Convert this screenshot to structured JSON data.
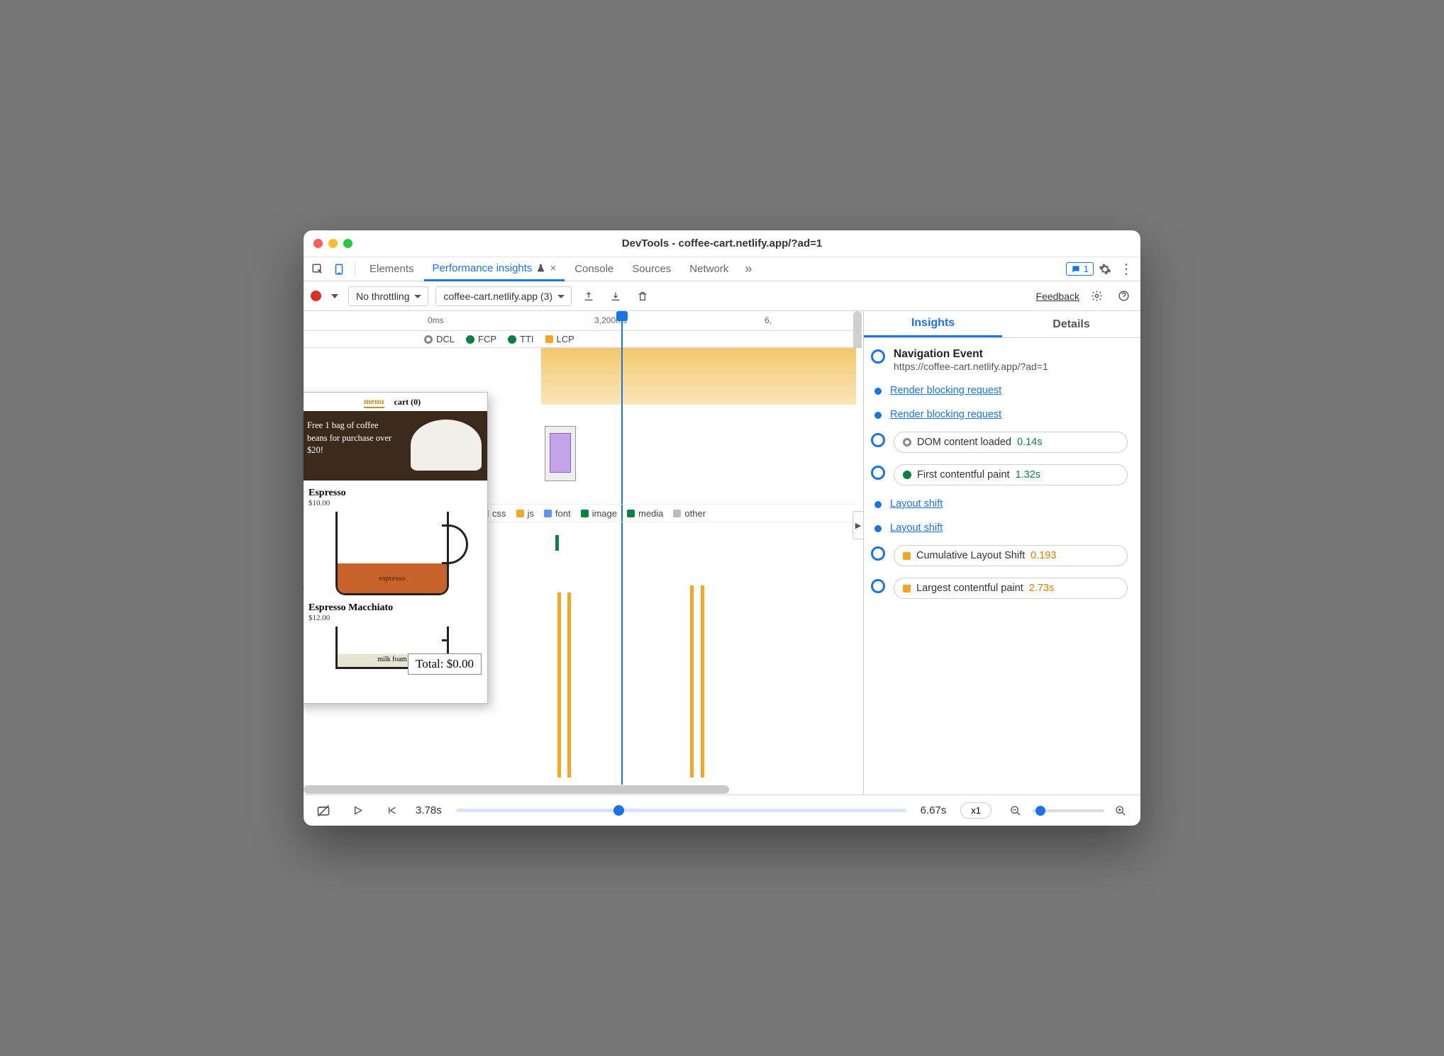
{
  "window": {
    "title": "DevTools - coffee-cart.netlify.app/?ad=1"
  },
  "tabs": {
    "elements": "Elements",
    "perf": "Performance insights",
    "console": "Console",
    "sources": "Sources",
    "network": "Network"
  },
  "badge": {
    "count": "1"
  },
  "toolbar": {
    "throttling": "No throttling",
    "session": "coffee-cart.netlify.app (3)",
    "feedback": "Feedback"
  },
  "ruler": {
    "t0": "0ms",
    "t1": "3,200ms",
    "t2": "6,"
  },
  "markers": {
    "dcl": "DCL",
    "fcp": "FCP",
    "tti": "TTI",
    "lcp": "LCP"
  },
  "legend": {
    "css": "css",
    "js": "js",
    "font": "font",
    "image": "image",
    "media": "media",
    "other": "other"
  },
  "right_tabs": {
    "insights": "Insights",
    "details": "Details"
  },
  "insights": {
    "nav_title": "Navigation Event",
    "nav_url": "https://coffee-cart.netlify.app/?ad=1",
    "rbr": "Render blocking request",
    "dcl_label": "DOM content loaded",
    "dcl_val": "0.14s",
    "fcp_label": "First contentful paint",
    "fcp_val": "1.32s",
    "ls": "Layout shift",
    "cls_label": "Cumulative Layout Shift",
    "cls_val": "0.193",
    "lcp_label": "Largest contentful paint",
    "lcp_val": "2.73s"
  },
  "bottom": {
    "cur": "3.78s",
    "end": "6.67s",
    "zoom": "x1"
  },
  "preview": {
    "menu": "menu",
    "cart": "cart (0)",
    "banner": "Free 1 bag of coffee beans for purchase over $20!",
    "item1": "Espresso",
    "price1": "$10.00",
    "fill1": "espresso",
    "item2": "Espresso Macchiato",
    "price2": "$12.00",
    "foam": "milk foam",
    "total": "Total: $0.00"
  }
}
